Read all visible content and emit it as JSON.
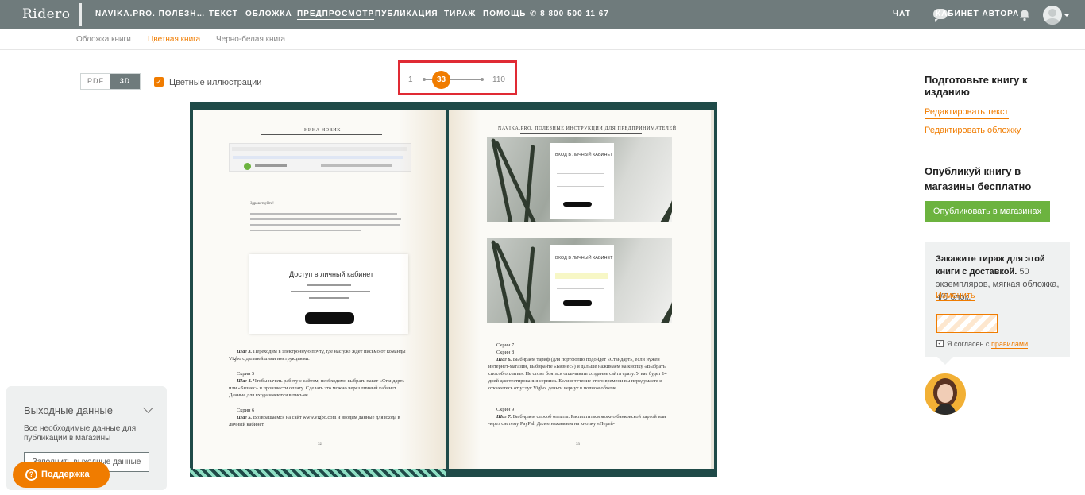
{
  "header": {
    "logo": "Ridero",
    "nav": [
      {
        "label": "NAVIKA.PRO. ПОЛЕЗН…"
      },
      {
        "label": "ТЕКСТ"
      },
      {
        "label": "ОБЛОЖКА"
      },
      {
        "label": "ПРЕДПРОСМОТР"
      },
      {
        "label": "ПУБЛИКАЦИЯ"
      },
      {
        "label": "ТИРАЖ"
      },
      {
        "label": "ПОМОЩЬ"
      },
      {
        "label": "✆ 8 800 500 11 67"
      }
    ],
    "chat": "ЧАТ",
    "cabinet": "КАБИНЕТ АВТОРА"
  },
  "subnav": [
    {
      "label": "Обложка книги"
    },
    {
      "label": "Цветная книга"
    },
    {
      "label": "Черно-белая книга"
    }
  ],
  "controls": {
    "pdf": "PDF",
    "threed": "3D",
    "color_illustrations": "Цветные иллюстрации",
    "pager_min": "1",
    "pager_current": "33",
    "pager_max": "110",
    "pager_current_fraction": 0.3
  },
  "left_page": {
    "running_title": "НИНА НОВИК",
    "greeting": "Здравствуйте!",
    "card_title": "Доступ в личный кабинет",
    "step3_bold": "Шаг 3.",
    "step3_text": "Переходим в электронную почту, где нас уже ждет письмо от команды Vigbo с дальнейшими инструкциями.",
    "screen5": "Скрин 5",
    "step4_bold": "Шаг 4.",
    "step4_text": "Чтобы начать работу с сайтом, необходимо выбрать пакет «Стандарт» или «Бизнес» и произвести оплату. Сделать это можно через личный кабинет. Данные для входа имеются в письме.",
    "screen6": "Скрин 6",
    "step5_bold": "Шаг 5.",
    "step5_text_pre": "Возвращаемся на сайт",
    "step5_link": "www.vigbo.com",
    "step5_text_post": "и вводим данные для входа в личный кабинет.",
    "page_number": "32"
  },
  "right_page": {
    "running_title": "NAVIKA.PRO. ПОЛЕЗНЫЕ ИНСТРУКЦИИ ДЛЯ ПРЕДПРИНИМАТЕЛЕЙ",
    "login_title_1": "ВХОД В ЛИЧНЫЙ КАБИНЕТ",
    "login_title_2": "ВХОД В ЛИЧНЫЙ КАБИНЕТ",
    "screen7": "Скрин 7",
    "screen8": "Скрин 8",
    "step6_bold": "Шаг 6.",
    "step6_text": "Выбираем тариф (для портфолио подойдет «Стандарт», если нужен интернет-магазин, выбирайте «Бизнес») и дальше нажимаем на кнопку «Выбрать способ оплаты». Не стоит бояться оплачивать создание сайта сразу. У вас будет 14 дней для тестирования сервиса. Если в течение этого времени вы передумаете и откажетесь от услуг Vigbo, деньги вернут в полном объеме.",
    "screen9": "Скрин 9",
    "step7_bold": "Шаг 7.",
    "step7_text": "Выбираем способ оплаты. Расплатиться можно банковской картой или через систему PayPal. Далее нажимаем на кнопку «Перей-",
    "page_number": "33"
  },
  "sidebar_right": {
    "prepare_title": "Подготовьте книгу к изданию",
    "edit_text": "Редактировать текст",
    "edit_cover": "Редактировать обложку",
    "publish_title": "Опубликуй книгу в магазины бесплатно",
    "publish_button": "Опубликовать в магазинах",
    "order_bold": "Закажите тираж для этой книги с доставкой.",
    "order_text": "50 экземпляров, мягкая обложка, ч/б блок.",
    "order_change": "Изменить",
    "agree_text": "Я согласен с",
    "agree_link": "правилами"
  },
  "output_panel": {
    "title": "Выходные данные",
    "description": "Все необходимые данные для публикации в магазины",
    "button": "Заполнить выходные данные"
  },
  "support": {
    "label": "Поддержка"
  },
  "colors": {
    "topbar": "#6f7b7c",
    "accent": "#f07c00",
    "green": "#6cb33f",
    "book_cover": "#1f4a48",
    "highlight": "#e02a34"
  }
}
